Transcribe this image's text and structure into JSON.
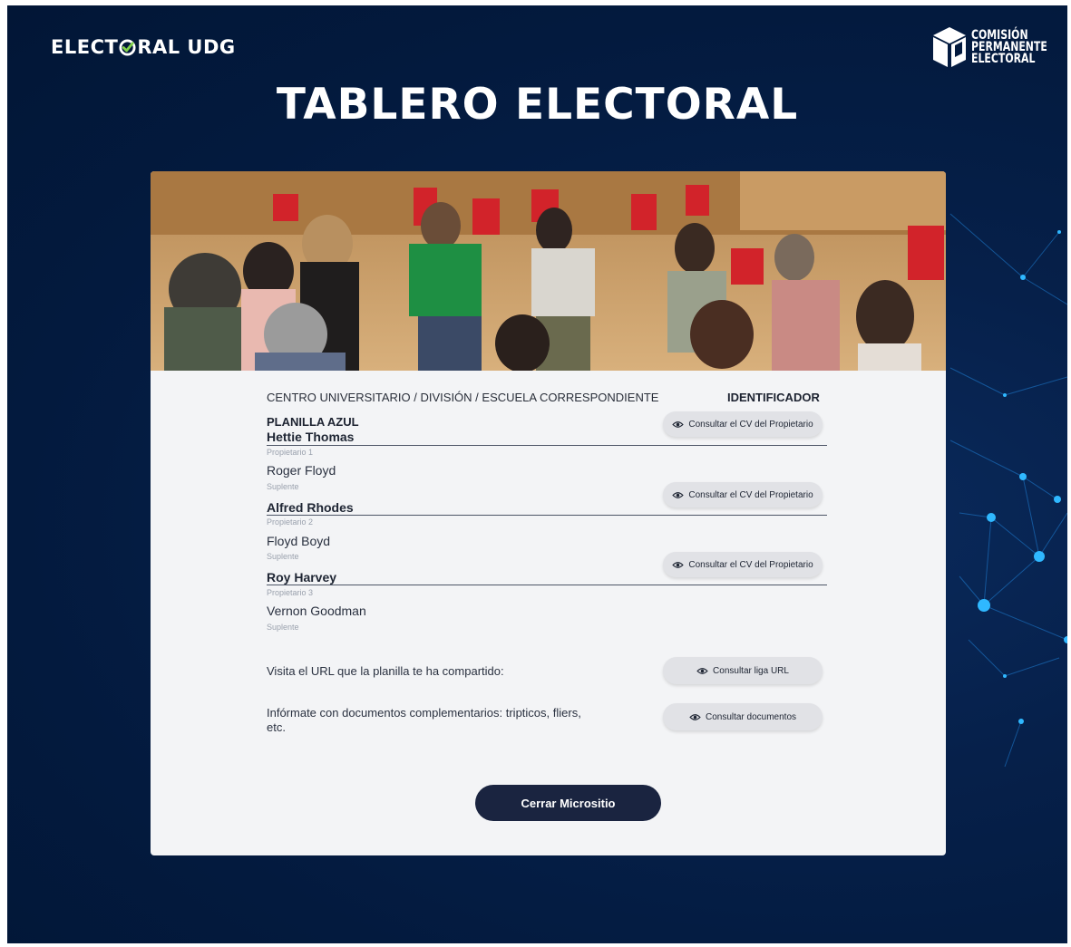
{
  "header": {
    "brand_left": "ELECT",
    "brand_right": "RAL UDG",
    "org_line1": "COMISIÓN",
    "org_line2": "PERMANENTE",
    "org_line3": "ELECTORAL",
    "title": "TABLERO ELECTORAL"
  },
  "card": {
    "section_label": "CENTRO UNIVERSITARIO / DIVISIÓN / ESCUELA CORRESPONDIENTE",
    "identifier_label": "IDENTIFICADOR",
    "planilla_name": "PLANILLA AZUL",
    "cv_button_label": "Consultar el CV del Propietario",
    "candidates": [
      {
        "owner": "Hettie Thomas",
        "owner_role": "Propietario 1",
        "substitute": "Roger Floyd",
        "substitute_role": "Suplente"
      },
      {
        "owner": "Alfred Rhodes",
        "owner_role": "Propietario 2",
        "substitute": "Floyd Boyd",
        "substitute_role": "Suplente"
      },
      {
        "owner": "Roy Harvey",
        "owner_role": "Propietario 3",
        "substitute": "Vernon Goodman",
        "substitute_role": "Suplente"
      }
    ],
    "url_prompt": "Visita el URL que la planilla te ha compartido:",
    "url_button_label": "Consultar liga URL",
    "docs_prompt": "Infórmate con documentos complementarios: tripticos, fliers, etc.",
    "docs_button_label": "Consultar documentos",
    "close_button_label": "Cerrar Micrositio"
  },
  "colors": {
    "background": "#031a3e",
    "card": "#f3f4f6",
    "pill": "#e1e2e6",
    "close_button": "#1a2440",
    "checkmark": "#7fd14a"
  }
}
